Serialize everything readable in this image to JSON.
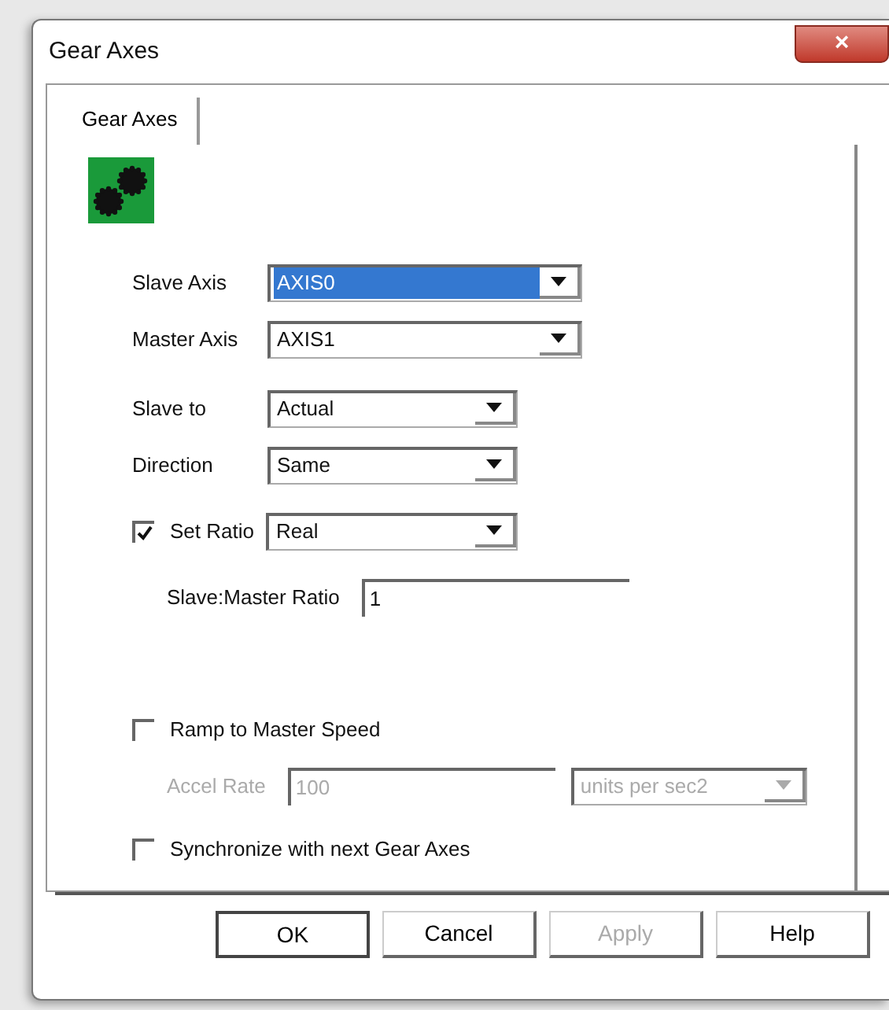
{
  "window": {
    "title": "Gear Axes",
    "close": "×"
  },
  "tabs": [
    {
      "label": "Gear Axes",
      "selected": true
    }
  ],
  "axes": [
    {
      "label": "Slave Axis",
      "value": "AXIS0",
      "highlighted": true,
      "disabled": false
    },
    {
      "label": "Master Axis",
      "value": "AXIS1",
      "highlighted": false,
      "disabled": false
    }
  ],
  "motion": [
    {
      "label": "Slave to",
      "value": "Actual",
      "highlighted": false,
      "disabled": false
    },
    {
      "label": "Direction",
      "value": "Same",
      "highlighted": false,
      "disabled": false
    }
  ],
  "set_ratio": {
    "label": "Set Ratio",
    "checked": true,
    "value": "Real",
    "ratio_label": "Slave:Master Ratio",
    "ratio_value": "1"
  },
  "ramp": {
    "label": "Ramp to Master Speed",
    "checked": false,
    "accel_label": "Accel Rate",
    "accel_value": "100",
    "units": "units per sec2",
    "disabled": true
  },
  "sync": {
    "label": "Synchronize with next Gear Axes",
    "checked": false
  },
  "buttons": [
    {
      "label": "OK",
      "disabled": false,
      "default": true
    },
    {
      "label": "Cancel",
      "disabled": false,
      "default": false
    },
    {
      "label": "Apply",
      "disabled": true,
      "default": false
    },
    {
      "label": "Help",
      "disabled": false,
      "default": false
    }
  ]
}
